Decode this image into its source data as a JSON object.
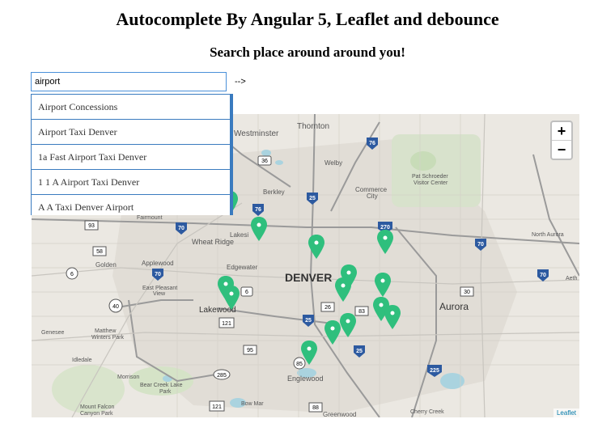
{
  "header": {
    "title": "Autocomplete By Angular 5, Leaflet and debounce",
    "subtitle": "Search place around around you!"
  },
  "search": {
    "value": "airport",
    "arrow_text": "-->"
  },
  "suggestions": [
    "Airport Concessions",
    "Airport Taxi Denver",
    "1a Fast Airport Taxi Denver",
    "1 1 A Airport Taxi Denver",
    "A A Taxi Denver Airport"
  ],
  "map": {
    "zoom_in": "+",
    "zoom_out": "−",
    "attribution": "Leaflet",
    "labels": {
      "thornton": "Thornton",
      "westminster": "Westminster",
      "welby": "Welby",
      "pat_schroeder": "Pat Schroeder",
      "visitor_center": "Visitor Center",
      "berkley": "Berkley",
      "commerce_city_1": "Commerce",
      "commerce_city_2": "City",
      "fairmount": "Fairmount",
      "lakeside": "Lakesi",
      "wheat_ridge": "Wheat Ridge",
      "north_aurora": "North Aurora",
      "golden": "Golden",
      "applewood": "Applewood",
      "edgewater": "Edgewater",
      "denver": "DENVER",
      "east_pleasant_1": "East Pleasant",
      "east_pleasant_2": "View",
      "lakewood": "Lakewood",
      "aurora": "Aurora",
      "aeth": "Aeth",
      "genesee": "Genesee",
      "matthew_1": "Matthew",
      "matthew_2": "Winters Park",
      "idledale": "Idledale",
      "morrison": "Morrison",
      "bear_creek_1": "Bear Creek Lake",
      "bear_creek_2": "Park",
      "englewood": "Englewood",
      "bow_mar": "Bow Mar",
      "greenwood": "Greenwood",
      "mount_falcon_1": "Mount Falcon",
      "mount_falcon_2": "Canyon Park",
      "cherry_creek": "Cherry Creek"
    },
    "shields": {
      "i76a": "76",
      "i76b": "76",
      "s36": "36",
      "i25a": "25",
      "i25b": "25",
      "i25c": "25",
      "i70a": "70",
      "i70b": "70",
      "i70c": "70",
      "i70d": "70",
      "i270": "270",
      "u93": "93",
      "u58": "58",
      "u6a": "6",
      "u6b": "6",
      "u40": "40",
      "u121a": "121",
      "u26": "26",
      "u83": "83",
      "u30": "30",
      "u95": "95",
      "u85": "85",
      "u285": "285",
      "i225": "225",
      "u121b": "121",
      "u88": "88"
    },
    "colors": {
      "marker": "#2fbf7d",
      "interstate": "#2d5aa0",
      "water": "#aad3df",
      "park": "#c8dcb8"
    }
  }
}
